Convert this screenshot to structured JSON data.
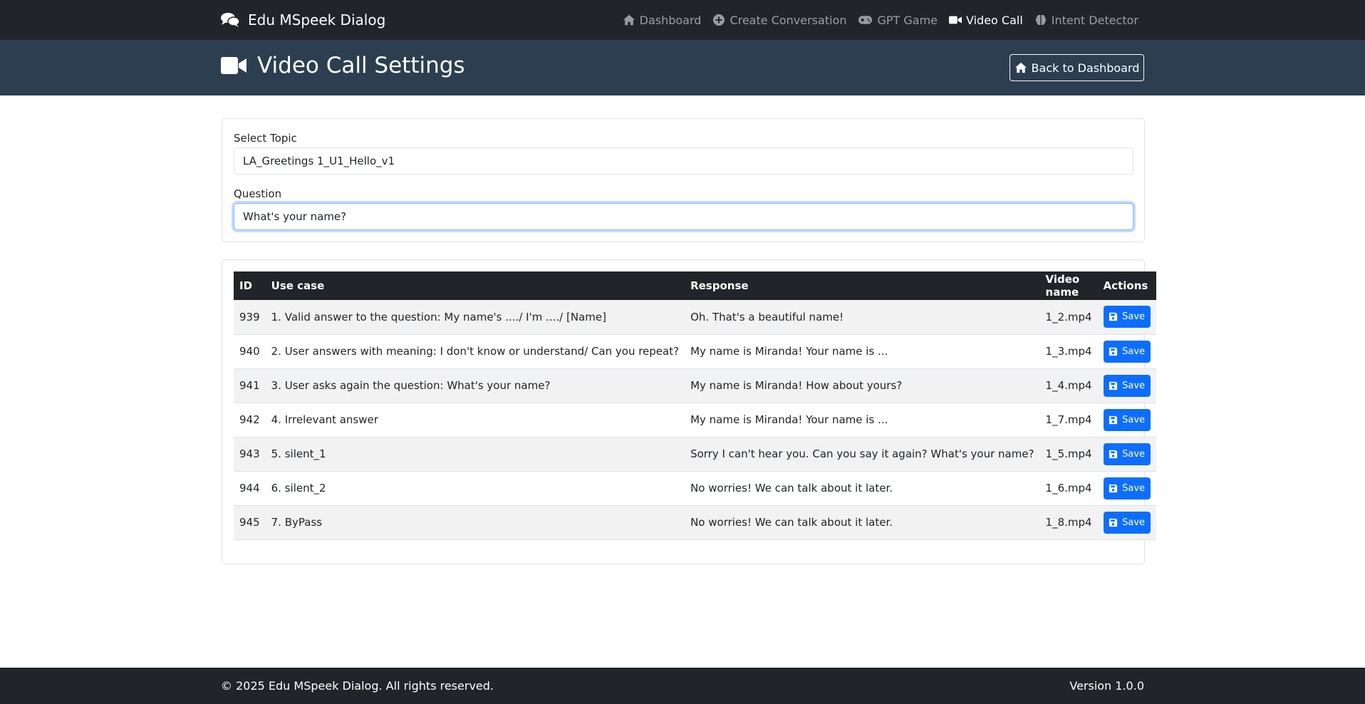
{
  "navbar": {
    "brand": "Edu MSpeek Dialog",
    "items": [
      {
        "label": "Dashboard",
        "icon": "home-icon",
        "active": false
      },
      {
        "label": "Create Conversation",
        "icon": "plus-circle-icon",
        "active": false
      },
      {
        "label": "GPT Game",
        "icon": "gamepad-icon",
        "active": false
      },
      {
        "label": "Video Call",
        "icon": "video-icon",
        "active": true
      },
      {
        "label": "Intent Detector",
        "icon": "brain-icon",
        "active": false
      }
    ]
  },
  "header": {
    "title": "Video Call Settings",
    "back_label": "Back to Dashboard"
  },
  "form": {
    "topic_label": "Select Topic",
    "topic_value": "LA_Greetings 1_U1_Hello_v1",
    "question_label": "Question",
    "question_value": "What's your name?"
  },
  "table": {
    "headers": [
      "ID",
      "Use case",
      "Response",
      "Video name",
      "Actions"
    ],
    "save_label": "Save",
    "rows": [
      {
        "id": "939",
        "use_case": "1. Valid answer to the question: My name's ..../ I'm ..../ [Name]",
        "response": "Oh. That's a beautiful name!",
        "video": "1_2.mp4"
      },
      {
        "id": "940",
        "use_case": "2. User answers with meaning: I don't know or understand/ Can you repeat?",
        "response": "My name is Miranda! Your name is ...",
        "video": "1_3.mp4"
      },
      {
        "id": "941",
        "use_case": "3. User asks again the question: What's your name?",
        "response": "My name is Miranda! How about yours?",
        "video": "1_4.mp4"
      },
      {
        "id": "942",
        "use_case": "4. Irrelevant answer",
        "response": "My name is Miranda! Your name is ...",
        "video": "1_7.mp4"
      },
      {
        "id": "943",
        "use_case": "5. silent_1",
        "response": "Sorry I can't hear you. Can you say it again? What's your name?",
        "video": "1_5.mp4"
      },
      {
        "id": "944",
        "use_case": "6. silent_2",
        "response": "No worries! We can talk about it later.",
        "video": "1_6.mp4"
      },
      {
        "id": "945",
        "use_case": "7. ByPass",
        "response": "No worries! We can talk about it later.",
        "video": "1_8.mp4"
      }
    ]
  },
  "footer": {
    "copyright": "© 2025 Edu MSpeek Dialog. All rights reserved.",
    "version": "Version 1.0.0"
  },
  "colors": {
    "navbar": "#212529",
    "header": "#2c3e50",
    "primary": "#0d6efd"
  }
}
